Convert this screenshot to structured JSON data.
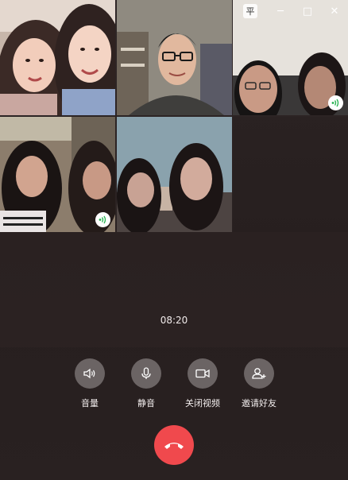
{
  "window": {
    "controls": {
      "pin": "平",
      "minimize": "─",
      "maximize": "□",
      "close": "✕"
    }
  },
  "participants": [
    {
      "id": "p1",
      "speaking": false
    },
    {
      "id": "p2",
      "speaking": false
    },
    {
      "id": "p3",
      "speaking": true
    },
    {
      "id": "p4",
      "speaking": true
    },
    {
      "id": "p5",
      "speaking": false
    }
  ],
  "call": {
    "duration": "08:20"
  },
  "controls": {
    "volume_label": "音量",
    "mute_label": "静音",
    "camera_off_label": "关闭视频",
    "invite_label": "邀请好友"
  },
  "colors": {
    "hangup": "#f0494d",
    "speaking_indicator": "#22b14c"
  }
}
